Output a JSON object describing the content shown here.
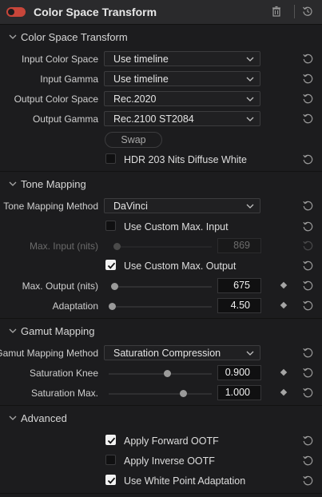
{
  "header": {
    "title": "Color Space Transform",
    "enabled": true
  },
  "sections": {
    "cst": {
      "title": "Color Space Transform"
    },
    "tone": {
      "title": "Tone Mapping"
    },
    "gamut": {
      "title": "Gamut Mapping"
    },
    "advanced": {
      "title": "Advanced"
    }
  },
  "fields": {
    "input_color_space": {
      "label": "Input Color Space",
      "value": "Use timeline"
    },
    "input_gamma": {
      "label": "Input Gamma",
      "value": "Use timeline"
    },
    "output_color_space": {
      "label": "Output Color Space",
      "value": "Rec.2020"
    },
    "output_gamma": {
      "label": "Output Gamma",
      "value": "Rec.2100 ST2084"
    },
    "swap": {
      "label": "Swap"
    },
    "hdr_203": {
      "label": "HDR 203 Nits Diffuse White",
      "checked": false
    },
    "tone_mapping_method": {
      "label": "Tone Mapping Method",
      "value": "DaVinci"
    },
    "custom_max_input": {
      "label": "Use Custom Max. Input",
      "checked": false
    },
    "max_input": {
      "label": "Max. Input (nits)",
      "value": "869",
      "level": 0.0
    },
    "custom_max_output": {
      "label": "Use Custom Max. Output",
      "checked": true
    },
    "max_output": {
      "label": "Max. Output (nits)",
      "value": "675",
      "level": 0.0
    },
    "adaptation": {
      "label": "Adaptation",
      "value": "4.50",
      "level": 0.0
    },
    "gamut_mapping_method": {
      "label": "Gamut Mapping Method",
      "value": "Saturation Compression"
    },
    "saturation_knee": {
      "label": "Saturation Knee",
      "value": "0.900",
      "level": 0.55
    },
    "saturation_max": {
      "label": "Saturation Max.",
      "value": "1.000",
      "level": 0.7
    },
    "apply_forward_ootf": {
      "label": "Apply Forward OOTF",
      "checked": true
    },
    "apply_inverse_ootf": {
      "label": "Apply Inverse OOTF",
      "checked": false
    },
    "white_point_adaptation": {
      "label": "Use White Point Adaptation",
      "checked": true
    }
  },
  "colors": {
    "toggle": "#c8463a",
    "background": "#1c1c1e",
    "header": "#2a2a2c"
  },
  "icons": {
    "trash": "trash-icon",
    "reset": "reset-icon",
    "reset_all": "reset-all-icon",
    "chevron": "chevron-down-icon",
    "keyframe": "keyframe-diamond-icon"
  }
}
